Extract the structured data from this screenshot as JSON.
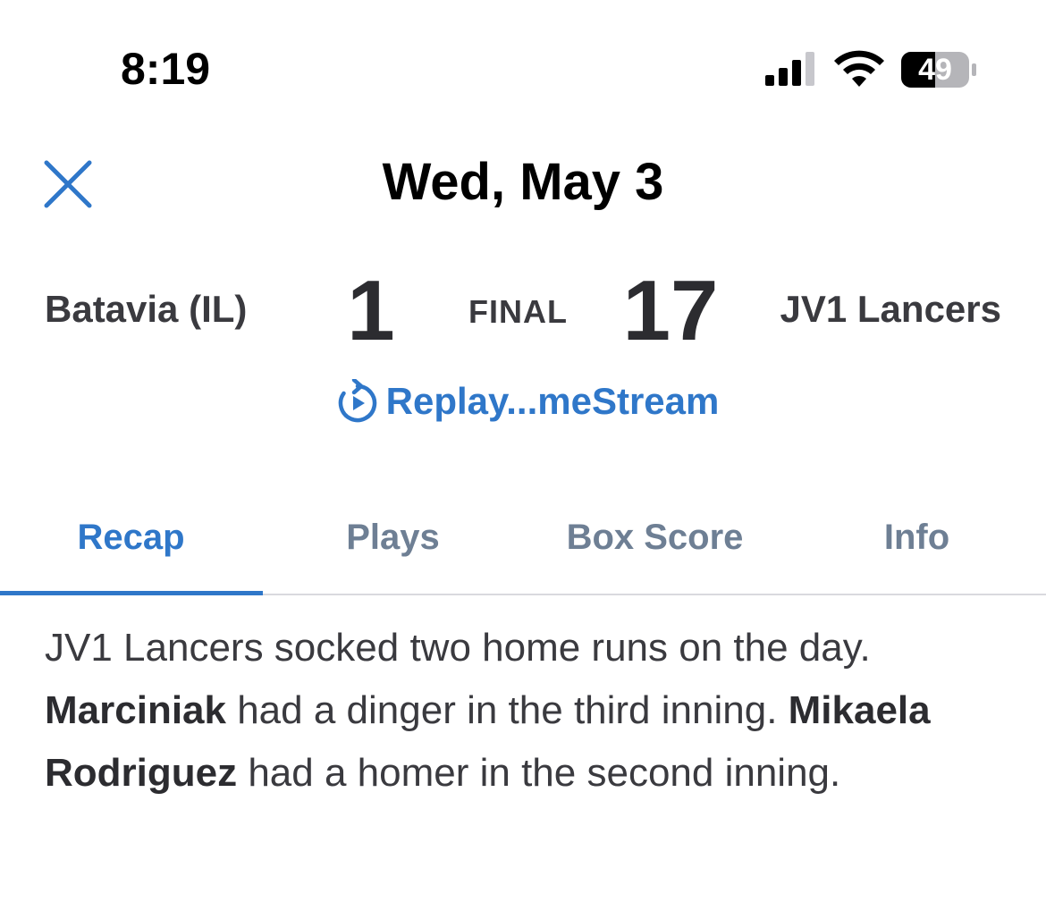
{
  "status_bar": {
    "time": "8:19",
    "battery_percent": "49",
    "icons": [
      "signal-icon",
      "wifi-icon",
      "battery-icon"
    ]
  },
  "header": {
    "title": "Wed, May 3",
    "close_icon": "close-icon"
  },
  "game": {
    "away_team": "Batavia (IL)",
    "away_score": "1",
    "status": "FINAL",
    "home_score": "17",
    "home_team": "JV1 Lancers"
  },
  "replay": {
    "label": "Replay...meStream",
    "icon": "replay-icon"
  },
  "tabs": [
    {
      "label": "Recap",
      "active": true
    },
    {
      "label": "Plays",
      "active": false
    },
    {
      "label": "Box Score",
      "active": false
    },
    {
      "label": "Info",
      "active": false
    }
  ],
  "recap": {
    "part1": "JV1 Lancers socked two home runs on the day. ",
    "player1": "Marciniak",
    "part2": " had a dinger in the third inning. ",
    "player2": "Mikaela Rodriguez",
    "part3": " had a homer in the second inning."
  },
  "colors": {
    "accent": "#2f77c9",
    "tab_inactive": "#6e7f94",
    "text": "#3a3a3f",
    "divider": "#d9d9de"
  }
}
